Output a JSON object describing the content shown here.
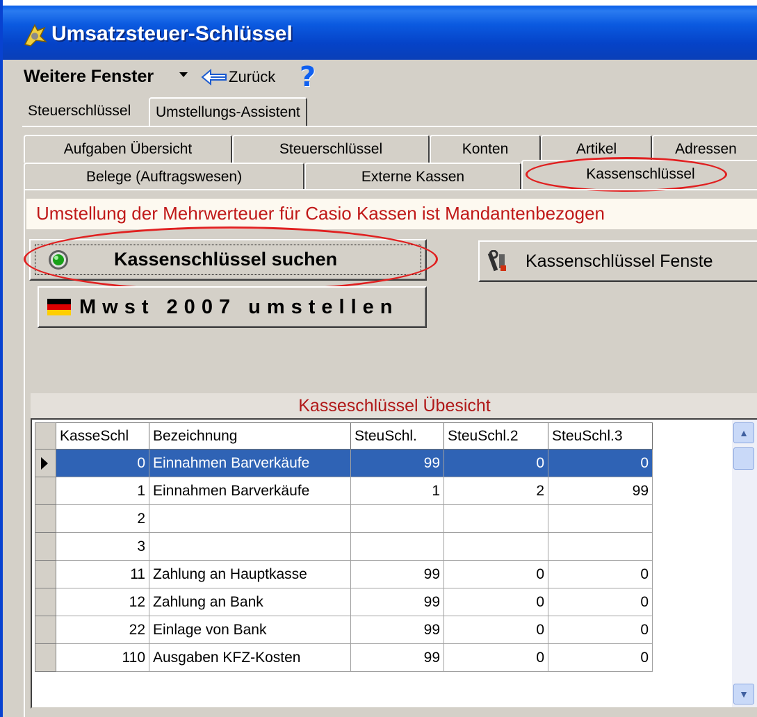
{
  "window": {
    "title": "Umsatzsteuer-Schlüssel"
  },
  "menu": {
    "more_windows": "Weitere Fenster",
    "back": "Zurück"
  },
  "top_tabs": [
    "Steuerschlüssel",
    "Umstellungs-Assistent"
  ],
  "sub_tabs_row1": [
    "Aufgaben Übersicht",
    "Steuerschlüssel",
    "Konten",
    "Artikel",
    "Adressen"
  ],
  "sub_tabs_row2": [
    "Belege (Auftragswesen)",
    "Externe Kassen",
    "Kassenschlüssel"
  ],
  "selected_sub_tab": "Kassenschlüssel",
  "info_text": "Umstellung der Mehrwerteuer für Casio Kassen ist Mandantenbezogen",
  "buttons": {
    "search": "Kassenschlüssel suchen",
    "window": "Kassenschlüssel Fenste",
    "mwst": "Mwst 2007 umstellen"
  },
  "grid": {
    "caption": "Kasseschlüssel Übesicht",
    "columns": [
      "KasseSchl",
      "Bezeichnung",
      "SteuSchl.",
      "SteuSchl.2",
      "SteuSchl.3"
    ],
    "rows": [
      [
        "0",
        "Einnahmen Barverkäufe",
        "99",
        "0",
        "0"
      ],
      [
        "1",
        "Einnahmen Barverkäufe",
        "1",
        "2",
        "99"
      ],
      [
        "2",
        "",
        "",
        "",
        ""
      ],
      [
        "3",
        "",
        "",
        "",
        ""
      ],
      [
        "11",
        "Zahlung an Hauptkasse",
        "99",
        "0",
        "0"
      ],
      [
        "12",
        "Zahlung an Bank",
        "99",
        "0",
        "0"
      ],
      [
        "22",
        "Einlage von Bank",
        "99",
        "0",
        "0"
      ],
      [
        "110",
        "Ausgaben KFZ-Kosten",
        "99",
        "0",
        "0"
      ]
    ],
    "selected_row": 0
  },
  "colors": {
    "title_bar": "#0543c8",
    "selection": "#2f63b5",
    "key_text": "#e01010",
    "info_text": "#c01818",
    "highlight_oval": "#e02020"
  }
}
